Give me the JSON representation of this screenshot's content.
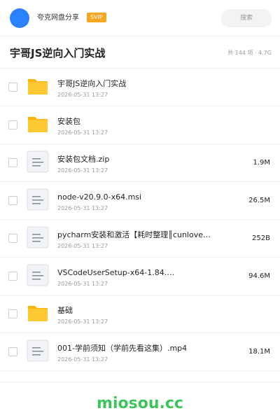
{
  "header": {
    "app_name": "夸克网盘分享",
    "badge": "SVIP",
    "search_placeholder": "搜索",
    "avatar_color": "#2a82ff"
  },
  "title_bar": {
    "title": "宇哥JS逆向入门实战",
    "summary": "共 144 项 · 4.7G"
  },
  "files": [
    {
      "name": "宇哥JS逆向入门实战",
      "date": "2026-05-31 13:27",
      "size": "",
      "icon": "folder-icon"
    },
    {
      "name": "安装包",
      "date": "2026-05-31 13:27",
      "size": "",
      "icon": "folder-icon"
    },
    {
      "name": "安装包文档.zip",
      "date": "2026-05-31 13:27",
      "size": "1.9M",
      "icon": "file-icon"
    },
    {
      "name": "node-v20.9.0-x64.msi",
      "date": "2026-05-31 13:27",
      "size": "26.5M",
      "icon": "file-icon"
    },
    {
      "name": "pycharm安装和激活【耗时整理║cunlove…",
      "date": "2026-05-31 13:27",
      "size": "252B",
      "icon": "file-icon"
    },
    {
      "name": "VSCodeUserSetup-x64-1.84.…",
      "date": "2026-05-31 13:27",
      "size": "94.6M",
      "icon": "file-icon"
    },
    {
      "name": "基础",
      "date": "2026-05-31 13:27",
      "size": "",
      "icon": "folder-icon"
    },
    {
      "name": "001-学前须知（学前先看这集）.mp4",
      "date": "2026-05-31 13:27",
      "size": "18.1M",
      "icon": "file-icon"
    }
  ],
  "watermark": "miosou.cc",
  "colors": {
    "folder": "#ffc933",
    "folder_tab": "#ffb400",
    "file_bg": "#f1f3f6",
    "file_line": "#8a9099",
    "badge": "#f5a623",
    "watermark": "#3ec25a"
  }
}
